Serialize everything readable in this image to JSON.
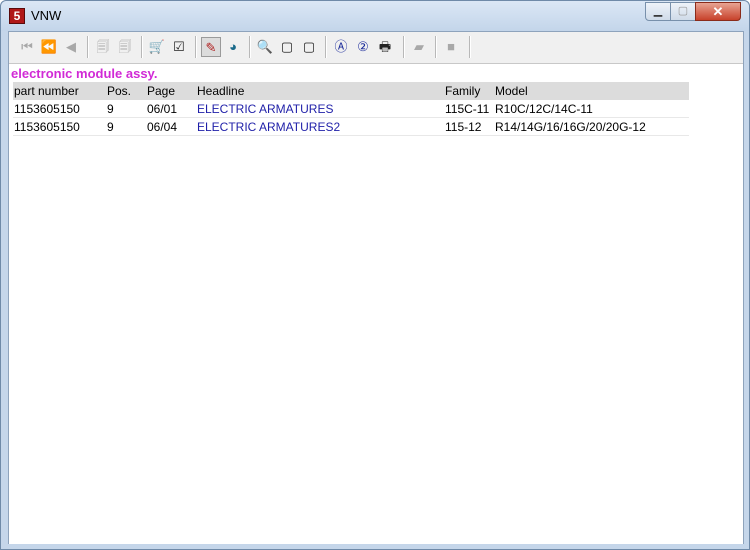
{
  "window": {
    "title": "VNW",
    "app_icon_letter": "5"
  },
  "toolbar": {
    "buttons": [
      {
        "name": "first-record-button",
        "glyph": "⏮",
        "enabled": false
      },
      {
        "name": "previous-page-button",
        "glyph": "⏪",
        "enabled": false
      },
      {
        "name": "previous-record-button",
        "glyph": "◀",
        "enabled": false
      },
      {
        "name": "back-doc-button",
        "glyph": "🗐",
        "enabled": false
      },
      {
        "name": "forward-doc-button",
        "glyph": "🗐",
        "enabled": false
      },
      {
        "name": "cart-button",
        "glyph": "🛒",
        "enabled": true
      },
      {
        "name": "checklist-button",
        "glyph": "☑",
        "enabled": true
      },
      {
        "name": "tag-button",
        "glyph": "✎",
        "enabled": true
      },
      {
        "name": "globe-button",
        "glyph": "◕",
        "enabled": true
      },
      {
        "name": "zoom-button",
        "glyph": "🔍",
        "enabled": true
      },
      {
        "name": "page-button",
        "glyph": "▢",
        "enabled": true
      },
      {
        "name": "page-alt-button",
        "glyph": "▢",
        "enabled": true
      },
      {
        "name": "a-button",
        "glyph": "Ⓐ",
        "enabled": true
      },
      {
        "name": "two-button",
        "glyph": "②",
        "enabled": true
      },
      {
        "name": "print-button",
        "glyph": "🖶",
        "enabled": true
      },
      {
        "name": "eraser-button",
        "glyph": "▰",
        "enabled": false
      },
      {
        "name": "stop-button",
        "glyph": "■",
        "enabled": false
      }
    ]
  },
  "main": {
    "section_title": "electronic module assy.",
    "columns": [
      "part number",
      "Pos.",
      "Page",
      "Headline",
      "Family",
      "Model"
    ],
    "rows": [
      [
        "1153605150",
        "9",
        "06/01",
        "ELECTRIC ARMATURES",
        "115C-11",
        "R10C/12C/14C-11"
      ],
      [
        "1153605150",
        "9",
        "06/04",
        "ELECTRIC ARMATURES2",
        "115-12",
        "R14/14G/16/16G/20/20G-12"
      ]
    ]
  }
}
